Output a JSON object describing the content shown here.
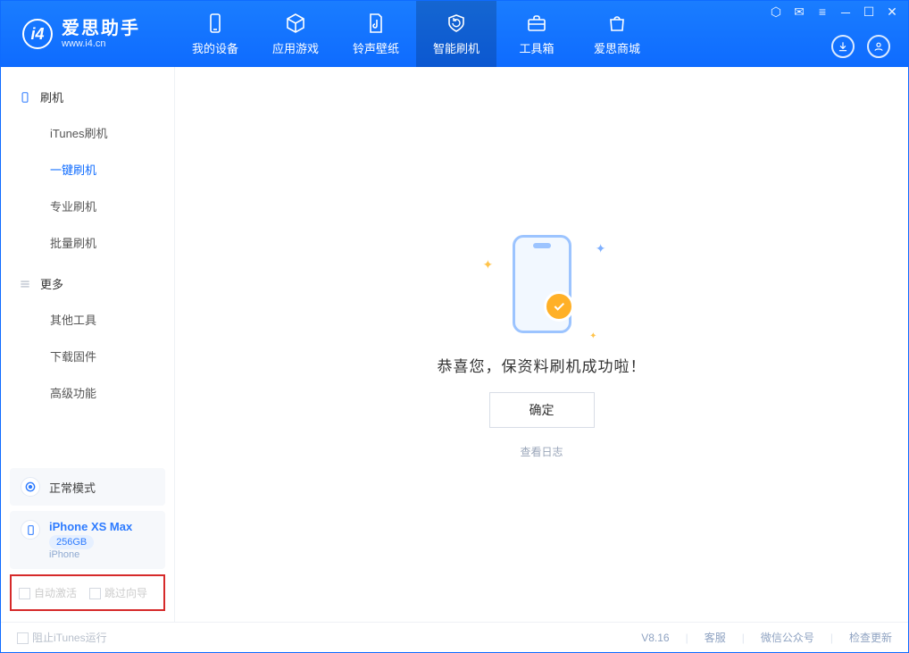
{
  "brand": {
    "title": "爱思助手",
    "sub": "www.i4.cn",
    "mark": "i4"
  },
  "nav": {
    "device": "我的设备",
    "apps": "应用游戏",
    "ringtone": "铃声壁纸",
    "flash": "智能刷机",
    "toolbox": "工具箱",
    "store": "爱思商城"
  },
  "sidebar": {
    "section1": {
      "title": "刷机",
      "items": [
        "iTunes刷机",
        "一键刷机",
        "专业刷机",
        "批量刷机"
      ]
    },
    "section2": {
      "title": "更多",
      "items": [
        "其他工具",
        "下载固件",
        "高级功能"
      ]
    },
    "mode": "正常模式",
    "device": {
      "name": "iPhone XS Max",
      "storage": "256GB",
      "type": "iPhone"
    },
    "opts": {
      "auto_activate": "自动激活",
      "skip_guide": "跳过向导"
    }
  },
  "main": {
    "success": "恭喜您，保资料刷机成功啦！",
    "ok": "确定",
    "log": "查看日志"
  },
  "footer": {
    "block_itunes": "阻止iTunes运行",
    "version": "V8.16",
    "cs": "客服",
    "wechat": "微信公众号",
    "update": "检查更新"
  }
}
